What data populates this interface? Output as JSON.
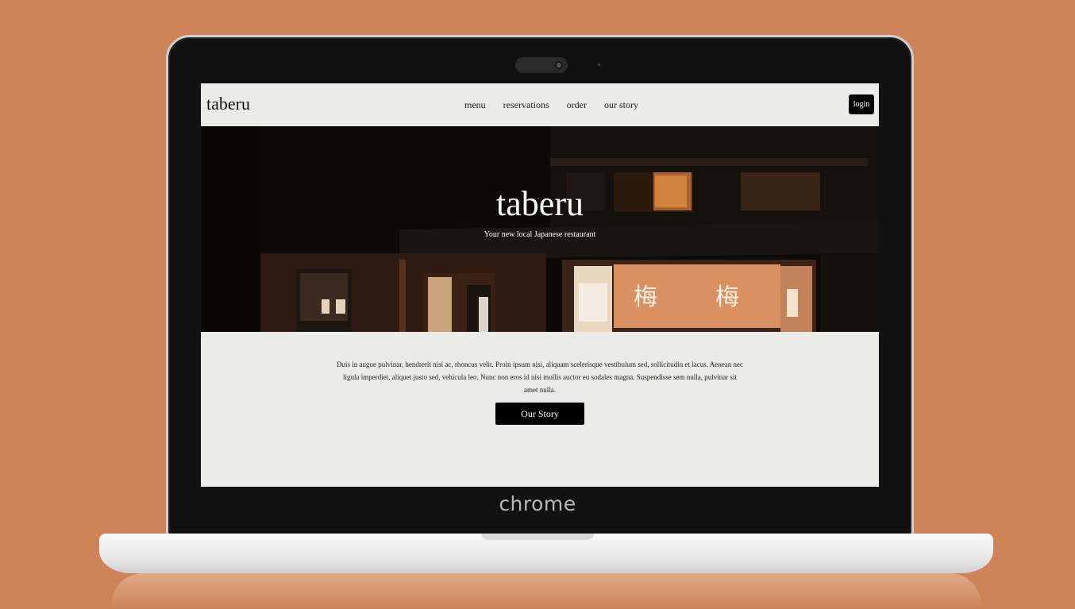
{
  "device": {
    "brand_text": "chrome"
  },
  "site": {
    "logo": "taberu",
    "nav_items": [
      "menu",
      "reservations",
      "order",
      "our story"
    ],
    "login_label": "login"
  },
  "hero": {
    "title": "taberu",
    "subtitle": "Your new local Japanese restaurant"
  },
  "content": {
    "paragraph": "Duis in augue pulvinar, hendrerit nisi ac, rhoncus velit. Proin ipsum nisi, aliquam scelerisque vestibulum sed, sollicitudin et lacus. Aenean nec ligula imperdiet, aliquet justo sed, vehicula leo. Nunc non eros id nisi mollis auctor eu sodales magna. Suspendisse sem nulla, pulvinar sit amet nulla.",
    "button_label": "Our Story"
  },
  "colors": {
    "background": "#cd8459",
    "page_bg": "#ebebe8",
    "button_bg": "#000000"
  },
  "icons": [
    "webcam-icon",
    "storefront-photo"
  ]
}
